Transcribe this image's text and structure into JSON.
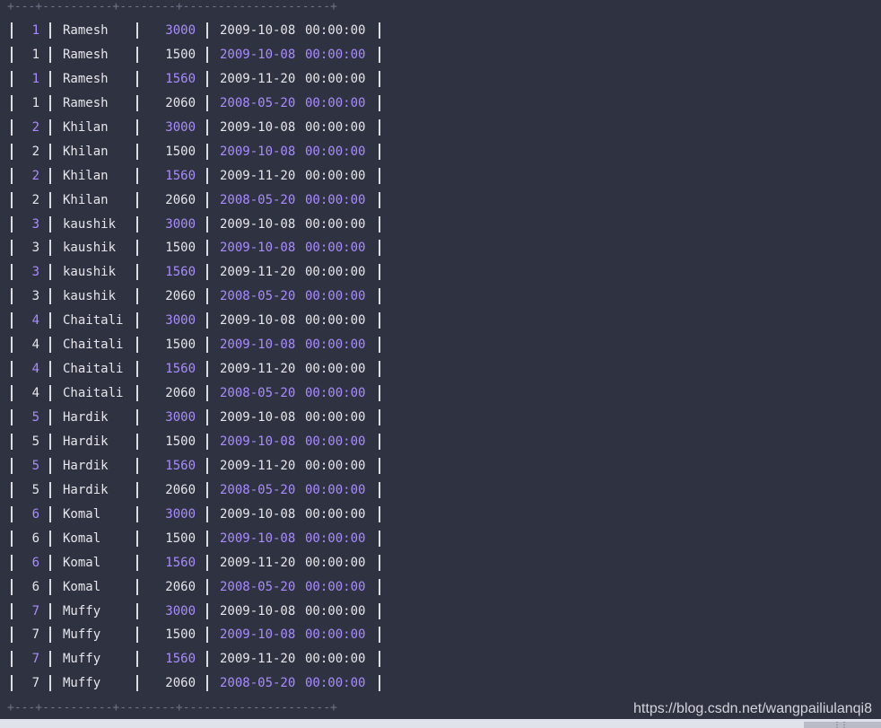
{
  "border": {
    "top": "+---+----------+--------+---------------------+",
    "bottom": "+---+----------+--------+---------------------+"
  },
  "colors": {
    "background": "#2f3241",
    "text": "#e6e6ea",
    "highlight": "#a98cff",
    "border": "#6f7386"
  },
  "rows": [
    {
      "id": "1",
      "name": "Ramesh",
      "amount": "3000",
      "date": "2009-10-08",
      "time": "00:00:00"
    },
    {
      "id": "1",
      "name": "Ramesh",
      "amount": "1500",
      "date": "2009-10-08",
      "time": "00:00:00"
    },
    {
      "id": "1",
      "name": "Ramesh",
      "amount": "1560",
      "date": "2009-11-20",
      "time": "00:00:00"
    },
    {
      "id": "1",
      "name": "Ramesh",
      "amount": "2060",
      "date": "2008-05-20",
      "time": "00:00:00"
    },
    {
      "id": "2",
      "name": "Khilan",
      "amount": "3000",
      "date": "2009-10-08",
      "time": "00:00:00"
    },
    {
      "id": "2",
      "name": "Khilan",
      "amount": "1500",
      "date": "2009-10-08",
      "time": "00:00:00"
    },
    {
      "id": "2",
      "name": "Khilan",
      "amount": "1560",
      "date": "2009-11-20",
      "time": "00:00:00"
    },
    {
      "id": "2",
      "name": "Khilan",
      "amount": "2060",
      "date": "2008-05-20",
      "time": "00:00:00"
    },
    {
      "id": "3",
      "name": "kaushik",
      "amount": "3000",
      "date": "2009-10-08",
      "time": "00:00:00"
    },
    {
      "id": "3",
      "name": "kaushik",
      "amount": "1500",
      "date": "2009-10-08",
      "time": "00:00:00"
    },
    {
      "id": "3",
      "name": "kaushik",
      "amount": "1560",
      "date": "2009-11-20",
      "time": "00:00:00"
    },
    {
      "id": "3",
      "name": "kaushik",
      "amount": "2060",
      "date": "2008-05-20",
      "time": "00:00:00"
    },
    {
      "id": "4",
      "name": "Chaitali",
      "amount": "3000",
      "date": "2009-10-08",
      "time": "00:00:00"
    },
    {
      "id": "4",
      "name": "Chaitali",
      "amount": "1500",
      "date": "2009-10-08",
      "time": "00:00:00"
    },
    {
      "id": "4",
      "name": "Chaitali",
      "amount": "1560",
      "date": "2009-11-20",
      "time": "00:00:00"
    },
    {
      "id": "4",
      "name": "Chaitali",
      "amount": "2060",
      "date": "2008-05-20",
      "time": "00:00:00"
    },
    {
      "id": "5",
      "name": "Hardik",
      "amount": "3000",
      "date": "2009-10-08",
      "time": "00:00:00"
    },
    {
      "id": "5",
      "name": "Hardik",
      "amount": "1500",
      "date": "2009-10-08",
      "time": "00:00:00"
    },
    {
      "id": "5",
      "name": "Hardik",
      "amount": "1560",
      "date": "2009-11-20",
      "time": "00:00:00"
    },
    {
      "id": "5",
      "name": "Hardik",
      "amount": "2060",
      "date": "2008-05-20",
      "time": "00:00:00"
    },
    {
      "id": "6",
      "name": "Komal",
      "amount": "3000",
      "date": "2009-10-08",
      "time": "00:00:00"
    },
    {
      "id": "6",
      "name": "Komal",
      "amount": "1500",
      "date": "2009-10-08",
      "time": "00:00:00"
    },
    {
      "id": "6",
      "name": "Komal",
      "amount": "1560",
      "date": "2009-11-20",
      "time": "00:00:00"
    },
    {
      "id": "6",
      "name": "Komal",
      "amount": "2060",
      "date": "2008-05-20",
      "time": "00:00:00"
    },
    {
      "id": "7",
      "name": "Muffy",
      "amount": "3000",
      "date": "2009-10-08",
      "time": "00:00:00"
    },
    {
      "id": "7",
      "name": "Muffy",
      "amount": "1500",
      "date": "2009-10-08",
      "time": "00:00:00"
    },
    {
      "id": "7",
      "name": "Muffy",
      "amount": "1560",
      "date": "2009-11-20",
      "time": "00:00:00"
    },
    {
      "id": "7",
      "name": "Muffy",
      "amount": "2060",
      "date": "2008-05-20",
      "time": "00:00:00"
    }
  ],
  "watermark": "https://blog.csdn.net/wangpailiulanqi8"
}
